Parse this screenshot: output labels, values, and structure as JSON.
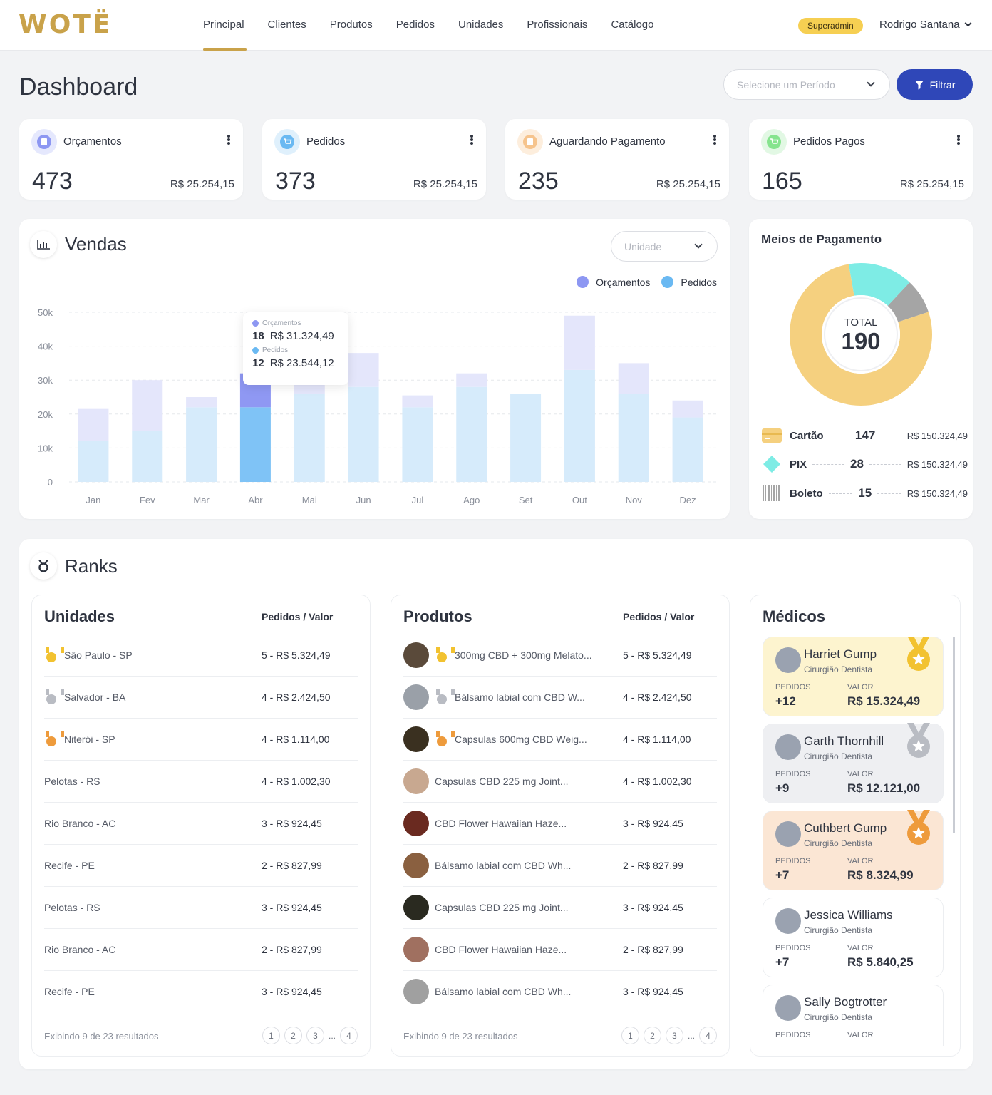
{
  "brand": {
    "logo": "WOTË"
  },
  "nav": {
    "items": [
      "Principal",
      "Clientes",
      "Produtos",
      "Pedidos",
      "Unidades",
      "Profissionais",
      "Catálogo"
    ],
    "active": 0
  },
  "user": {
    "role": "Superadmin",
    "name": "Rodrigo Santana"
  },
  "page": {
    "title": "Dashboard",
    "period_placeholder": "Selecione um Período",
    "filter_label": "Filtrar"
  },
  "stats": [
    {
      "label": "Orçamentos",
      "count": "473",
      "value": "R$ 25.254,15",
      "color": "#8d97f2",
      "bg": "#e5e8fd"
    },
    {
      "label": "Pedidos",
      "count": "373",
      "value": "R$ 25.254,15",
      "color": "#6ab9f2",
      "bg": "#dff0fc"
    },
    {
      "label": "Aguardando Pagamento",
      "count": "235",
      "value": "R$ 25.254,15",
      "color": "#f6c48d",
      "bg": "#fdeedd"
    },
    {
      "label": "Pedidos Pagos",
      "count": "165",
      "value": "R$ 25.254,15",
      "color": "#86e48e",
      "bg": "#e2f8e4"
    }
  ],
  "sales": {
    "title": "Vendas",
    "unit_placeholder": "Unidade",
    "tooltip": {
      "label1": "Orçamentos",
      "qty1": "18",
      "val1": "R$ 31.324,49",
      "label2": "Pedidos",
      "qty2": "12",
      "val2": "R$ 23.544,12"
    }
  },
  "chart_data": {
    "type": "bar",
    "stacked": true,
    "categories": [
      "Jan",
      "Fev",
      "Mar",
      "Abr",
      "Mai",
      "Jun",
      "Jul",
      "Ago",
      "Set",
      "Out",
      "Nov",
      "Dez"
    ],
    "ylim": [
      0,
      50000
    ],
    "y_ticks": [
      "0",
      "10k",
      "20k",
      "30k",
      "40k",
      "50k"
    ],
    "series": [
      {
        "name": "Pedidos",
        "color": "#6ab9f2",
        "values": [
          12000,
          15000,
          22000,
          22000,
          26000,
          28000,
          22000,
          28000,
          26000,
          33000,
          26000,
          19000
        ]
      },
      {
        "name": "Orçamentos",
        "color": "#8d97f2",
        "values": [
          9500,
          15000,
          3000,
          10000,
          4000,
          10000,
          3500,
          4000,
          0,
          16000,
          9000,
          5000
        ]
      }
    ],
    "highlight_index": 3,
    "legend_position": "top-right",
    "grid": true
  },
  "payments": {
    "title": "Meios de Pagamento",
    "total_label": "TOTAL",
    "total": "190",
    "donut": [
      {
        "name": "Cartão",
        "value": 147,
        "color": "#f5d07f"
      },
      {
        "name": "Boleto",
        "value": 15,
        "color": "#a5a5a5"
      },
      {
        "name": "PIX",
        "value": 28,
        "color": "#7eece5"
      }
    ],
    "rows": [
      {
        "name": "Cartão",
        "count": "147",
        "value": "R$ 150.324,49",
        "icon": "card-icon"
      },
      {
        "name": "PIX",
        "count": "28",
        "value": "R$ 150.324,49",
        "icon": "pix-icon"
      },
      {
        "name": "Boleto",
        "count": "15",
        "value": "R$ 150.324,49",
        "icon": "barcode-icon"
      }
    ]
  },
  "ranks": {
    "title": "Ranks",
    "units": {
      "title": "Unidades",
      "header": "Pedidos / Valor",
      "footer": "Exibindo 9 de 23 resultados",
      "pages": [
        "1",
        "2",
        "3",
        "...",
        "4"
      ],
      "rows": [
        {
          "name": "São Paulo - SP",
          "value": "5 - R$ 5.324,49",
          "medal": "gold"
        },
        {
          "name": "Salvador - BA",
          "value": "4 - R$ 2.424,50",
          "medal": "silver"
        },
        {
          "name": "Niterói - SP",
          "value": "4 - R$ 1.114,00",
          "medal": "bronze"
        },
        {
          "name": "Pelotas - RS",
          "value": "4 - R$ 1.002,30",
          "medal": ""
        },
        {
          "name": "Rio Branco - AC",
          "value": "3 - R$ 924,45",
          "medal": ""
        },
        {
          "name": "Recife - PE",
          "value": "2 - R$ 827,99",
          "medal": ""
        },
        {
          "name": "Pelotas - RS",
          "value": "3 - R$ 924,45",
          "medal": ""
        },
        {
          "name": "Rio Branco - AC",
          "value": "2 - R$ 827,99",
          "medal": ""
        },
        {
          "name": "Recife - PE",
          "value": "3 - R$ 924,45",
          "medal": ""
        }
      ]
    },
    "products": {
      "title": "Produtos",
      "header": "Pedidos / Valor",
      "footer": "Exibindo 9 de 23 resultados",
      "pages": [
        "1",
        "2",
        "3",
        "...",
        "4"
      ],
      "rows": [
        {
          "name": "300mg CBD + 300mg Melato...",
          "value": "5 - R$ 5.324,49",
          "medal": "gold"
        },
        {
          "name": "Bálsamo labial com CBD W...",
          "value": "4 - R$ 2.424,50",
          "medal": "silver"
        },
        {
          "name": "Capsulas 600mg CBD Weig...",
          "value": "4 - R$ 1.114,00",
          "medal": "bronze"
        },
        {
          "name": "Capsulas CBD 225 mg Joint...",
          "value": "4 - R$ 1.002,30",
          "medal": ""
        },
        {
          "name": "CBD Flower Hawaiian Haze...",
          "value": "3 - R$ 924,45",
          "medal": ""
        },
        {
          "name": "Bálsamo labial com CBD Wh...",
          "value": "2 - R$ 827,99",
          "medal": ""
        },
        {
          "name": "Capsulas CBD 225 mg Joint...",
          "value": "3 - R$ 924,45",
          "medal": ""
        },
        {
          "name": "CBD Flower Hawaiian Haze...",
          "value": "2 - R$ 827,99",
          "medal": ""
        },
        {
          "name": "Bálsamo labial com CBD Wh...",
          "value": "3 - R$ 924,45",
          "medal": ""
        }
      ]
    },
    "doctors": {
      "title": "Médicos",
      "orders_label": "PEDIDOS",
      "value_label": "VALOR",
      "rows": [
        {
          "name": "Harriet Gump",
          "role": "Cirurgião Dentista",
          "orders": "+12",
          "value": "R$ 15.324,49",
          "bg": "#fdf4cf",
          "medal": "gold"
        },
        {
          "name": "Garth Thornhill",
          "role": "Cirurgião Dentista",
          "orders": "+9",
          "value": "R$ 12.121,00",
          "bg": "#eeeff2",
          "medal": "silver"
        },
        {
          "name": "Cuthbert Gump",
          "role": "Cirurgião Dentista",
          "orders": "+7",
          "value": "R$ 8.324,99",
          "bg": "#fbe6d4",
          "medal": "bronze"
        },
        {
          "name": "Jessica Williams",
          "role": "Cirurgião Dentista",
          "orders": "+7",
          "value": "R$ 5.840,25",
          "bg": "#ffffff",
          "medal": ""
        },
        {
          "name": "Sally Bogtrotter",
          "role": "Cirurgião Dentista",
          "orders": "",
          "value": "",
          "bg": "#ffffff",
          "medal": ""
        }
      ]
    }
  }
}
